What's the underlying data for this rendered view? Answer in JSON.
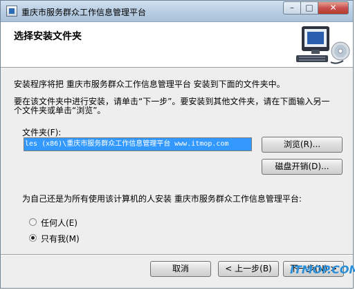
{
  "window": {
    "title": "重庆市服务群众工作信息管理平台",
    "controls": {
      "minimize": "–",
      "maximize": "□",
      "close": "✕"
    }
  },
  "header": {
    "title": "选择安装文件夹",
    "icon": "computer-with-cd-icon"
  },
  "body": {
    "intro": "安装程序将把 重庆市服务群众工作信息管理平台 安装到下面的文件夹中。",
    "instruction_line1": "要在该文件夹中进行安装，请单击“下一步”。要安装到其他文件夹，请在下面输入另一",
    "instruction_line2": "个文件夹或单击“浏览”。"
  },
  "folder": {
    "label": "文件夹(F):",
    "value": "les (x86)\\重庆市服务群众工作信息管理平台 www.itmop.com",
    "browse_button": "浏览(R)...",
    "disk_cost_button": "磁盘开销(D)..."
  },
  "install_for": {
    "label": "为自己还是为所有使用该计算机的人安装 重庆市服务群众工作信息管理平台:",
    "options": [
      {
        "label": "任何人(E)",
        "selected": false
      },
      {
        "label": "只有我(M)",
        "selected": true
      }
    ]
  },
  "footer": {
    "cancel": "取消",
    "back": "< 上一步(B)",
    "next": "下一步(N) >"
  },
  "watermark": "ITMOP.COM",
  "colors": {
    "selection": "#3399ff",
    "close_button": "#c75050",
    "watermark": "#2a8ed8"
  }
}
